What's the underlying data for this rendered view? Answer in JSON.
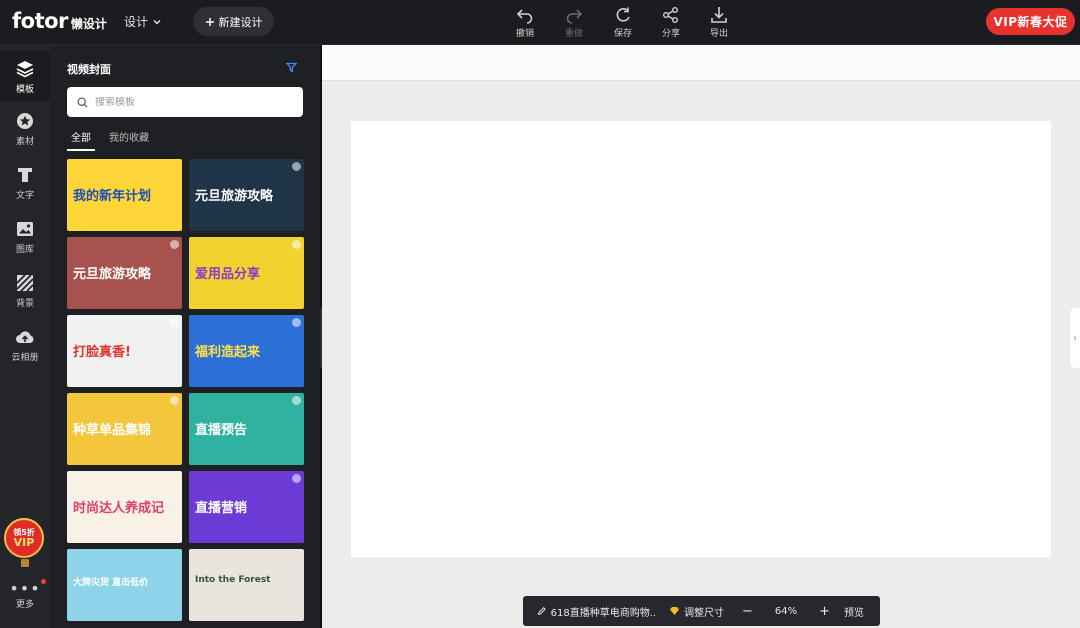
{
  "app": {
    "logo_word": "fotor",
    "logo_sub": "懒设计",
    "design_menu": "设计",
    "new_design": "新建设计",
    "vip_label": "VIP新春大促"
  },
  "toolbar": [
    {
      "id": "undo",
      "label": "撤销",
      "icon": "undo-icon",
      "enabled": true
    },
    {
      "id": "redo",
      "label": "重做",
      "icon": "redo-icon",
      "enabled": false
    },
    {
      "id": "save",
      "label": "保存",
      "icon": "save-icon",
      "enabled": true
    },
    {
      "id": "share",
      "label": "分享",
      "icon": "share-icon",
      "enabled": true
    },
    {
      "id": "export",
      "label": "导出",
      "icon": "download-icon",
      "enabled": true
    }
  ],
  "rail": [
    {
      "id": "template",
      "label": "模板",
      "icon": "layers-icon",
      "active": true
    },
    {
      "id": "material",
      "label": "素材",
      "icon": "star-icon",
      "active": false
    },
    {
      "id": "text",
      "label": "文字",
      "icon": "text-icon",
      "active": false
    },
    {
      "id": "gallery",
      "label": "图库",
      "icon": "image-icon",
      "active": false
    },
    {
      "id": "background",
      "label": "背景",
      "icon": "hatch-icon",
      "active": false
    },
    {
      "id": "cloud",
      "label": "云相册",
      "icon": "cloud-upload-icon",
      "active": false
    }
  ],
  "rail_vip": {
    "line1": "领5折",
    "line2": "VIP"
  },
  "rail_more": "更多",
  "panel": {
    "title": "视频封面",
    "search_placeholder": "搜索模板",
    "tabs": [
      {
        "label": "全部",
        "active": true
      },
      {
        "label": "我的收藏",
        "active": false
      }
    ]
  },
  "templates": [
    {
      "text": "我的新年计划",
      "bg": "#ffd638",
      "fg": "#1c4fb5",
      "premium": false
    },
    {
      "text": "元旦旅游攻略",
      "bg": "#203447",
      "fg": "#ffffff",
      "premium": true
    },
    {
      "text": "元旦旅游攻略",
      "bg": "#a7524e",
      "fg": "#ffffff",
      "premium": true
    },
    {
      "text": "爱用品分享",
      "bg": "#f2d22e",
      "fg": "#8a3cc9",
      "premium": true
    },
    {
      "text": "打脸真香!",
      "bg": "#f1f1f1",
      "fg": "#e0322e",
      "premium": true
    },
    {
      "text": "福利造起来",
      "bg": "#2c6fd6",
      "fg": "#ffe14a",
      "premium": true
    },
    {
      "text": "种草单品集锦",
      "bg": "#f3c63b",
      "fg": "#ffffff",
      "premium": true
    },
    {
      "text": "直播预告",
      "bg": "#2fb3a0",
      "fg": "#ffffff",
      "premium": true
    },
    {
      "text": "时尚达人养成记",
      "bg": "#f7f1e6",
      "fg": "#e43d6b",
      "premium": false
    },
    {
      "text": "直播营销",
      "bg": "#6c3bd6",
      "fg": "#ffffff",
      "premium": true
    },
    {
      "text": "大牌尖货 直击低价",
      "bg": "#8fd3e8",
      "fg": "#ffffff",
      "premium": false
    },
    {
      "text": "Into the Forest",
      "bg": "#e9e4dc",
      "fg": "#2f5640",
      "premium": false
    }
  ],
  "bottombar": {
    "doc_name": "618直播种草电商购物...",
    "resize": "调整尺寸",
    "zoom": "64%",
    "preview": "预览"
  }
}
